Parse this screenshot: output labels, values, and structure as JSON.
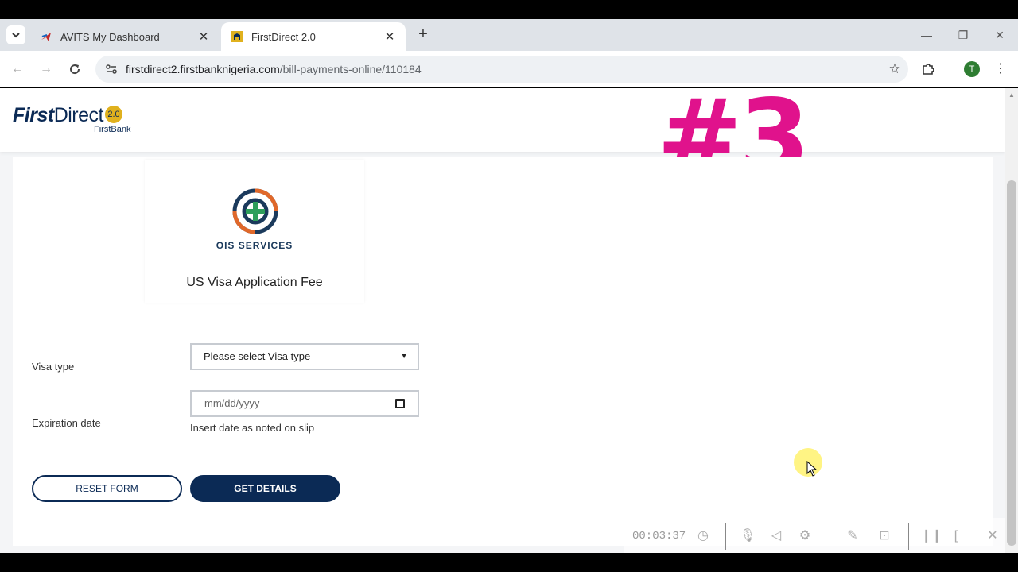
{
  "browser": {
    "tabs": [
      {
        "title": "AVITS My Dashboard",
        "active": false,
        "favicon": "airplane-icon"
      },
      {
        "title": "FirstDirect 2.0",
        "active": true,
        "favicon": "firstbank-elephant-icon"
      }
    ],
    "url_host": "firstdirect2.firstbanknigeria.com",
    "url_path": "/bill-payments-online/110184",
    "profile_initial": "T",
    "profile_color": "#2e7d32"
  },
  "header": {
    "logo_first": "First",
    "logo_direct": "Direct",
    "logo_version": "2.0",
    "logo_sub": "FirstBank",
    "overlay_text": "#3"
  },
  "biller": {
    "brand": "OIS SERVICES",
    "name": "US Visa Application Fee"
  },
  "form": {
    "visa_type_label": "Visa type",
    "visa_type_value": "Please select Visa type",
    "expiration_label": "Expiration date",
    "expiration_placeholder": "mm/dd/yyyy",
    "expiration_hint": "Insert date as noted on slip",
    "reset_label": "RESET FORM",
    "get_details_label": "GET DETAILS"
  },
  "recorder": {
    "elapsed": "00:03:37"
  },
  "colors": {
    "brand_navy": "#0b2a55",
    "brand_gold": "#e0b11e",
    "overlay_magenta": "#e0128c"
  }
}
